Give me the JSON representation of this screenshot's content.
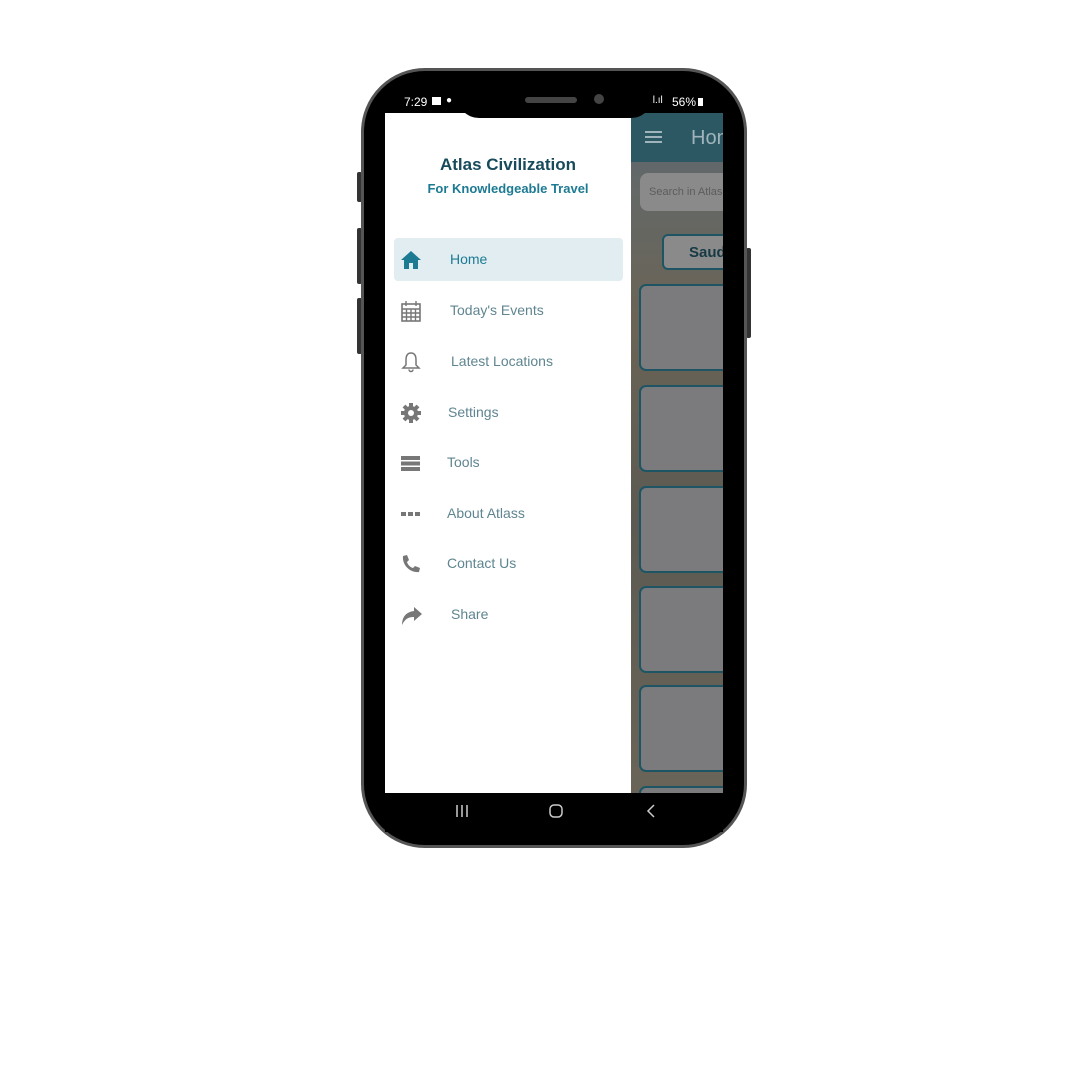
{
  "status_bar": {
    "time": "7:29",
    "battery": "56%"
  },
  "drawer": {
    "title": "Atlas Civilization",
    "subtitle": "For Knowledgeable Travel",
    "items": [
      {
        "label": "Home",
        "icon": "home-icon",
        "active": true
      },
      {
        "label": "Today's Events",
        "icon": "calendar-icon"
      },
      {
        "label": "Latest Locations",
        "icon": "bell-icon"
      },
      {
        "label": "Settings",
        "icon": "gear-icon"
      },
      {
        "label": "Tools",
        "icon": "server-icon"
      },
      {
        "label": "About Atlass",
        "icon": "dots-icon"
      },
      {
        "label": "Contact Us",
        "icon": "phone-icon"
      },
      {
        "label": "Share",
        "icon": "share-icon"
      }
    ]
  },
  "main": {
    "title": "Home",
    "search_placeholder": "Search in Atlas",
    "chip": "Saud"
  },
  "colors": {
    "primary": "#174b5c",
    "accent": "#1d7a93",
    "active_bg": "#e1edf1"
  }
}
